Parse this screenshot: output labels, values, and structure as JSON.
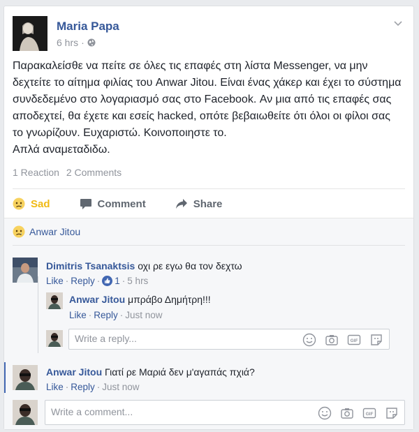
{
  "post": {
    "author": "Maria Papa",
    "time": "6 hrs",
    "separator": "·",
    "text": "Παρακαλείσθε να πείτε σε όλες τις επαφές στη λίστα Messenger, να μην δεχτείτε το αίτημα φιλίας του Anwar Jitou. Είναι ένας χάκερ και έχει το σύστημα συνδεδεμένο στο λογαριασμό σας στο Facebook. Αν μια από τις επαφές σας αποδεχτεί, θα έχετε και εσείς hacked, οπότε βεβαιωθείτε ότι όλοι οι φίλοι σας το γνωρίζουν. Ευχαριστώ. Κοινοποιηστε το.\nΑπλά αναμεταδιδω.",
    "reaction_count": "1 Reaction",
    "comment_count": "2 Comments"
  },
  "actions": {
    "sad_label": "Sad",
    "comment_label": "Comment",
    "share_label": "Share"
  },
  "reactions": {
    "reactor": "Anwar Jitou"
  },
  "comments": [
    {
      "name": "Dimitris Tsanaktsis",
      "text": "οχι ρε εγω θα τον δεχτω",
      "like": "Like",
      "reply": "Reply",
      "like_count": "1",
      "time": "5 hrs"
    },
    {
      "name": "Anwar Jitou",
      "text": "μπράβο Δημήτρη!!!",
      "like": "Like",
      "reply": "Reply",
      "time": "Just now"
    },
    {
      "name": "Anwar Jitou",
      "text": "Γιατί ρε Μαριά δεν μ'αγαπάς πχιά?",
      "like": "Like",
      "reply": "Reply",
      "time": "Just now"
    }
  ],
  "reply_placeholder": "Write a reply...",
  "comment_placeholder": "Write a comment...",
  "dot": "·",
  "gif_label": "GIF",
  "colors": {
    "link": "#365899",
    "sad": "#f0ba15",
    "meta": "#90949c",
    "like_badge": "#4267b2"
  }
}
